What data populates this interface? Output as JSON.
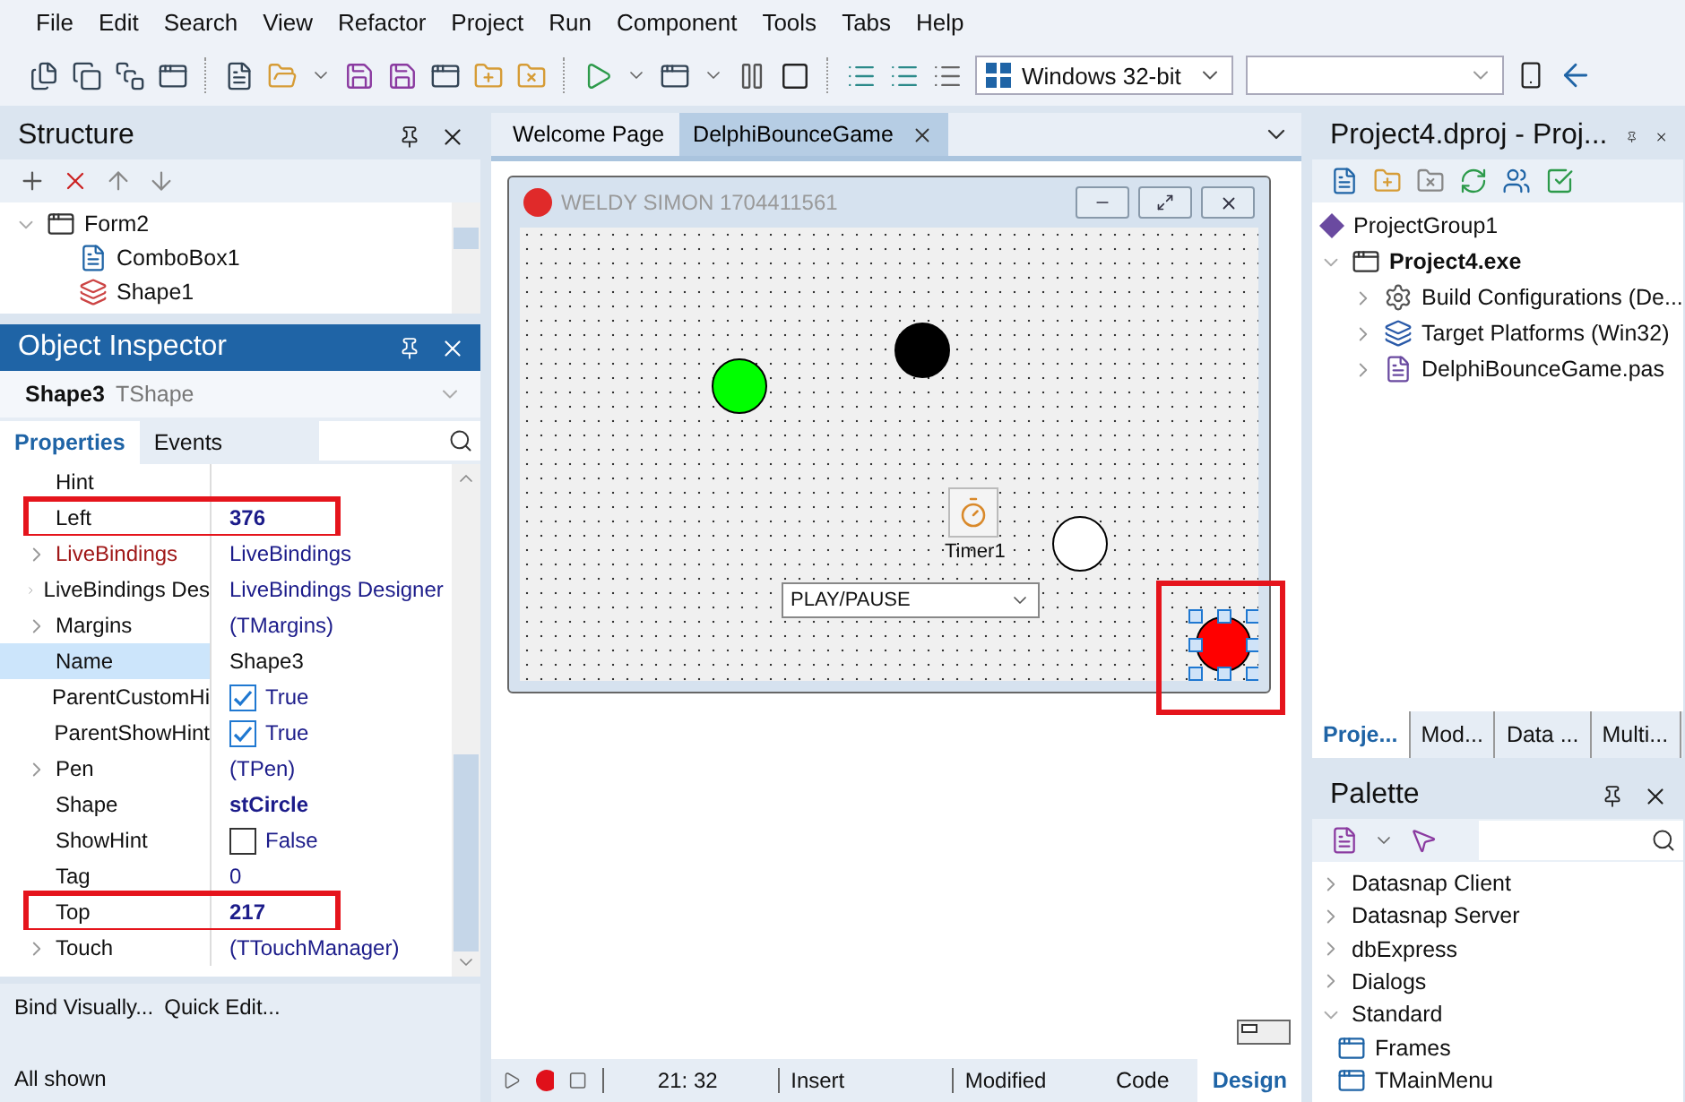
{
  "menu": [
    "File",
    "Edit",
    "Search",
    "View",
    "Refactor",
    "Project",
    "Run",
    "Component",
    "Tools",
    "Tabs",
    "Help"
  ],
  "toolbar": {
    "platform": "Windows 32-bit"
  },
  "structure": {
    "title": "Structure",
    "tree": [
      {
        "label": "Form2",
        "expanded": true,
        "children": [
          {
            "label": "ComboBox1"
          },
          {
            "label": "Shape1"
          }
        ]
      }
    ]
  },
  "inspector": {
    "title": "Object Inspector",
    "object_name": "Shape3",
    "object_type": "TShape",
    "tabs": [
      {
        "label": "Properties",
        "selected": true
      },
      {
        "label": "Events",
        "selected": false
      }
    ],
    "properties": [
      {
        "name": "Hint",
        "kind": "text",
        "expandable": false,
        "highlighted": false,
        "selected": false
      },
      {
        "name": "Left",
        "value": "376",
        "kind": "text",
        "expandable": false,
        "bold": true,
        "highlighted": true,
        "selected": false
      },
      {
        "name": "LiveBindings",
        "value": "LiveBindings",
        "kind": "text",
        "expandable": true,
        "bold": false,
        "highlighted": false,
        "selected": false,
        "color": "#a01818"
      },
      {
        "name": "LiveBindings Des",
        "value": "LiveBindings Designer",
        "kind": "text",
        "expandable": true,
        "bold": false,
        "highlighted": false,
        "selected": false
      },
      {
        "name": "Margins",
        "value": "(TMargins)",
        "kind": "text",
        "expandable": true,
        "bold": false,
        "highlighted": false,
        "selected": false
      },
      {
        "name": "Name",
        "value": "Shape3",
        "kind": "text",
        "expandable": false,
        "bold": false,
        "highlighted": false,
        "selected": true
      },
      {
        "name": "ParentCustomHi",
        "value": "True",
        "kind": "checkbox",
        "checked": true,
        "expandable": false,
        "bold": false,
        "highlighted": false,
        "selected": false
      },
      {
        "name": "ParentShowHint",
        "value": "True",
        "kind": "checkbox",
        "checked": true,
        "expandable": false,
        "bold": false,
        "highlighted": false,
        "selected": false
      },
      {
        "name": "Pen",
        "value": "(TPen)",
        "kind": "text",
        "expandable": true,
        "bold": false,
        "highlighted": false,
        "selected": false
      },
      {
        "name": "Shape",
        "value": "stCircle",
        "kind": "text",
        "expandable": false,
        "bold": true,
        "highlighted": false,
        "selected": false
      },
      {
        "name": "ShowHint",
        "value": "False",
        "kind": "checkbox",
        "checked": false,
        "expandable": false,
        "bold": false,
        "highlighted": false,
        "selected": false
      },
      {
        "name": "Tag",
        "value": "0",
        "kind": "text",
        "expandable": false,
        "bold": false,
        "highlighted": false,
        "selected": false
      },
      {
        "name": "Top",
        "value": "217",
        "kind": "text",
        "expandable": false,
        "bold": true,
        "highlighted": true,
        "selected": false
      },
      {
        "name": "Touch",
        "value": "(TTouchManager)",
        "kind": "text",
        "expandable": true,
        "bold": false,
        "highlighted": false,
        "selected": false
      }
    ],
    "footer": {
      "actions": [
        "Bind Visually...",
        "Quick Edit..."
      ],
      "status": "All shown"
    }
  },
  "editor": {
    "tabs": [
      {
        "label": "Welcome Page",
        "selected": false
      },
      {
        "label": "DelphiBounceGame",
        "selected": true
      }
    ],
    "form": {
      "caption": "WELDY SIMON 1704411561",
      "shapes": [
        {
          "color": "#00ff00",
          "selected": false
        },
        {
          "color": "#000000",
          "selected": false
        },
        {
          "color": "#ffffff",
          "selected": false
        },
        {
          "color": "#ff0000",
          "selected": true
        }
      ],
      "timer": "Timer1",
      "combo": "PLAY/PAUSE"
    },
    "status": {
      "position": "21: 32",
      "mode": "Insert",
      "state": "Modified",
      "views": [
        {
          "label": "Code",
          "selected": false
        },
        {
          "label": "Design",
          "selected": true
        }
      ]
    }
  },
  "project": {
    "title": "Project4.dproj - Proj...",
    "group": "ProjectGroup1",
    "project": {
      "label": "Project4.exe",
      "expanded": true
    },
    "items": [
      {
        "label": "Build Configurations (De...",
        "expanded": false
      },
      {
        "label": "Target Platforms (Win32)",
        "expanded": false
      },
      {
        "label": "DelphiBounceGame.pas",
        "expanded": false
      }
    ],
    "tabs": [
      {
        "label": "Proje...",
        "selected": true
      },
      {
        "label": "Mod...",
        "selected": false
      },
      {
        "label": "Data ...",
        "selected": false
      },
      {
        "label": "Multi...",
        "selected": false
      }
    ]
  },
  "palette": {
    "title": "Palette",
    "categories": [
      {
        "label": "Datasnap Client",
        "expanded": false
      },
      {
        "label": "Datasnap Server",
        "expanded": false
      },
      {
        "label": "dbExpress",
        "expanded": false
      },
      {
        "label": "Dialogs",
        "expanded": false
      },
      {
        "label": "Standard",
        "expanded": true,
        "children": [
          "Frames",
          "TMainMenu"
        ]
      }
    ]
  }
}
